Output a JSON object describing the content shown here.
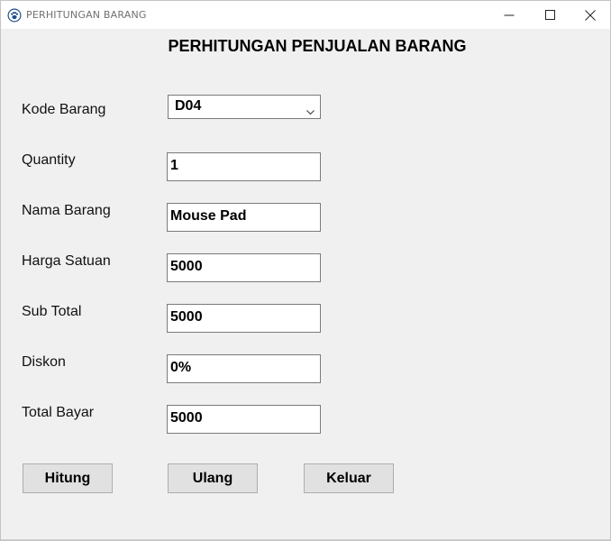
{
  "window": {
    "title": "PERHITUNGAN BARANG",
    "app_icon": "paw-icon",
    "controls": [
      "minimize-icon",
      "maximize-icon",
      "close-icon"
    ]
  },
  "form": {
    "heading": "PERHITUNGAN PENJUALAN BARANG",
    "kode_barang": {
      "label": "Kode Barang",
      "value": "D04"
    },
    "quantity": {
      "label": "Quantity",
      "value": "1"
    },
    "nama_barang": {
      "label": "Nama Barang",
      "value": "Mouse Pad"
    },
    "harga_satuan": {
      "label": "Harga Satuan",
      "value": "5000"
    },
    "sub_total": {
      "label": "Sub Total",
      "value": "5000"
    },
    "diskon": {
      "label": "Diskon",
      "value": "0%"
    },
    "total_bayar": {
      "label": "Total Bayar",
      "value": "5000"
    }
  },
  "buttons": {
    "hitung": "Hitung",
    "ulang": "Ulang",
    "keluar": "Keluar"
  }
}
